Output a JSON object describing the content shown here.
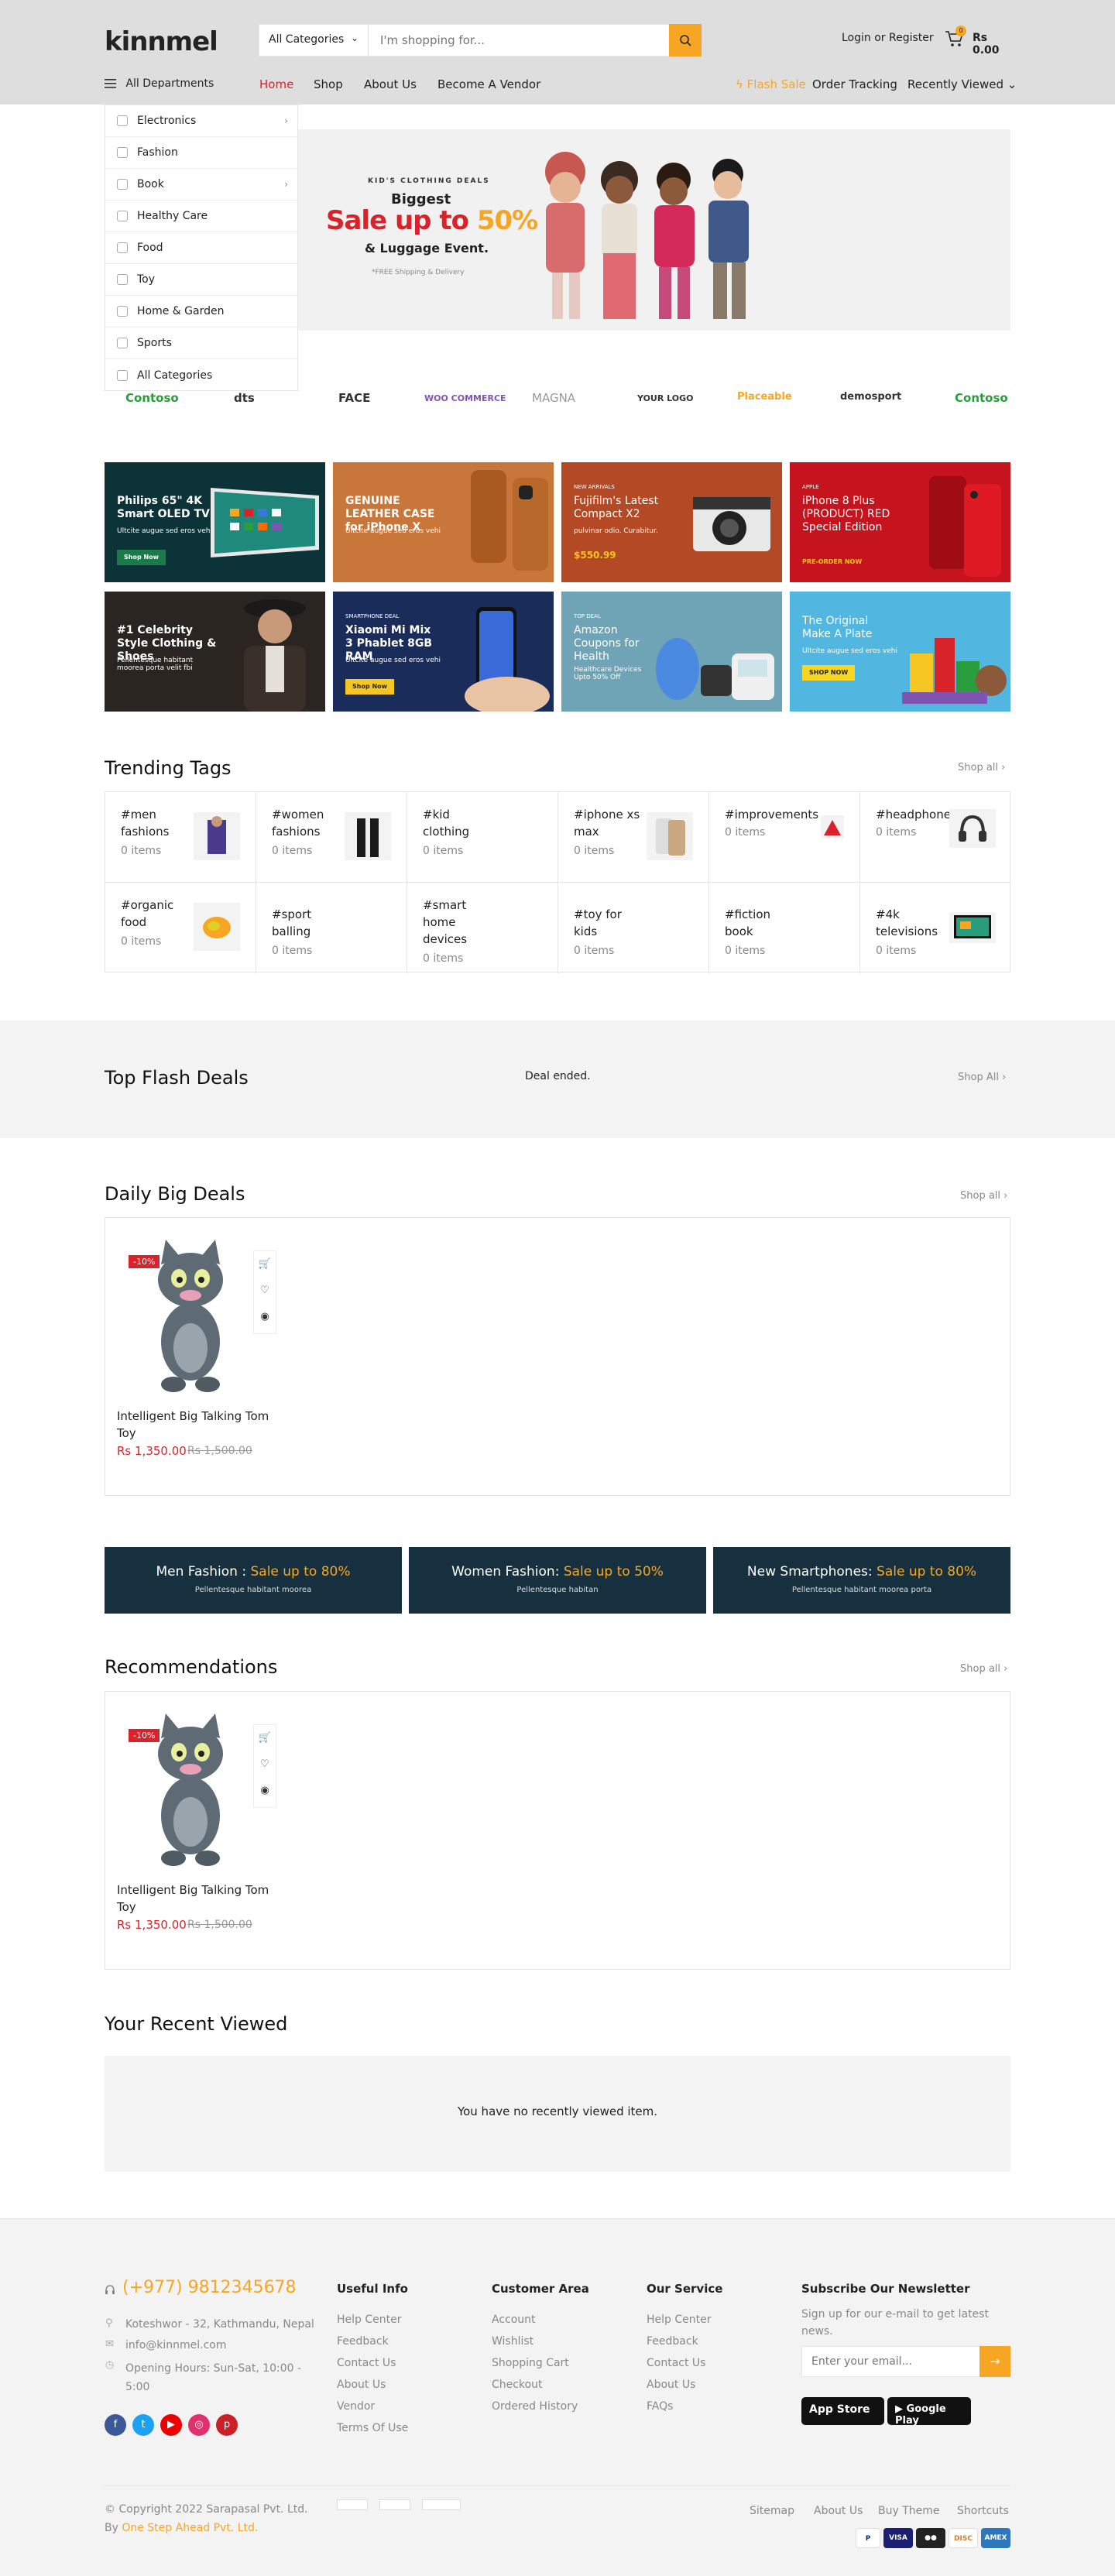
{
  "header": {
    "logo_main": "kinnmel",
    "category_select": "All Categories",
    "search_placeholder": "I'm shopping for...",
    "login": "Login or Register",
    "cart_count": "0",
    "cart_total": "Rs 0.00"
  },
  "nav": {
    "all_departments": "All Departments",
    "menu": [
      "Home",
      "Shop",
      "About Us",
      "Become A Vendor"
    ],
    "right": [
      "Flash Sale",
      "Order Tracking",
      "Recently Viewed"
    ]
  },
  "departments": [
    "Electronics",
    "Fashion",
    "Book",
    "Healthy Care",
    "Food",
    "Toy",
    "Home & Garden",
    "Sports",
    "All Categories"
  ],
  "hero": {
    "eyebrow": "KID'S CLOTHING DEALS",
    "line1": "Biggest",
    "line2": "Sale up to ",
    "line2_accent": "50%",
    "line3": "& Luggage Event.",
    "foot": "*FREE Shipping & Delivery"
  },
  "brands": [
    "Contoso",
    "dts",
    "FACE",
    "WOO COMMERCE",
    "MAGNA",
    "YOUR LOGO",
    "Placeable",
    "demosport",
    "Contoso"
  ],
  "promos": [
    {
      "title": "Philips 65\" 4K Smart OLED TV",
      "sub": "Ultcite augue sed eros vehi",
      "btn": "Shop Now",
      "bg": "#0c3438"
    },
    {
      "title": "GENUINE LEATHER CASE for iPhone X",
      "sub": "Ultcite augue sed eros vehi",
      "btn": "",
      "bg": "#c9763a"
    },
    {
      "title": "Fujifilm's Latest Compact X2",
      "sub": "pulvinar odio. Curabitur.",
      "btn": "$550.99",
      "eyebrow": "NEW ARRIVALS",
      "bg": "#b34a25"
    },
    {
      "title": "iPhone 8 Plus (PRODUCT) RED Special Edition",
      "sub": "",
      "btn": "PRE-ORDER NOW",
      "eyebrow": "APPLE",
      "bg": "#c5141e"
    },
    {
      "title": "#1 Celebrity Style Clothing & Shoes",
      "sub": "Pellentesque habitant moorea porta velit fbi",
      "btn": "",
      "bg": "#2b2522"
    },
    {
      "title": "Xiaomi Mi Mix 3 Phablet 8GB RAM",
      "sub": "Ultcite augue sed eros vehi",
      "btn": "Shop Now",
      "eyebrow": "SMARTPHONE DEAL",
      "bg": "#1a2d5a"
    },
    {
      "title": "Amazon Coupons for Health",
      "sub": "Healthcare Devices Upto 50% Off",
      "btn": "",
      "eyebrow": "TOP DEAL",
      "bg": "#6fa4b6"
    },
    {
      "title": "The Original Make A Plate",
      "sub": "Ultcite augue sed eros vehi",
      "btn": "SHOP NOW",
      "bg": "#52b7e0"
    }
  ],
  "trending": {
    "title": "Trending Tags",
    "shop_all": "Shop all",
    "tags": [
      {
        "name": "#men fashions",
        "count": "0 items"
      },
      {
        "name": "#women fashions",
        "count": "0 items"
      },
      {
        "name": "#kid clothing",
        "count": "0 items"
      },
      {
        "name": "#iphone xs max",
        "count": "0 items"
      },
      {
        "name": "#improvements",
        "count": "0 items"
      },
      {
        "name": "#headphones",
        "count": "0 items"
      },
      {
        "name": "#organic food",
        "count": "0 items"
      },
      {
        "name": "#sport balling",
        "count": "0 items"
      },
      {
        "name": "#smart home devices",
        "count": "0 items"
      },
      {
        "name": "#toy for kids",
        "count": "0 items"
      },
      {
        "name": "#fiction book",
        "count": "0 items"
      },
      {
        "name": "#4k televisions",
        "count": "0 items"
      }
    ]
  },
  "flash": {
    "title": "Top Flash Deals",
    "status": "Deal ended.",
    "shop_all": "Shop All"
  },
  "daily": {
    "title": "Daily Big Deals",
    "shop_all": "Shop all"
  },
  "product": {
    "discount": "-10%",
    "name": "Intelligent Big Talking Tom Toy",
    "price": "Rs 1,350.00",
    "old_price": "Rs 1,500.00"
  },
  "dark_banners": [
    {
      "a": "Men Fashion : ",
      "accent": "Sale up to 80%",
      "b": "Pellentesque habitant moorea"
    },
    {
      "a": "Women Fashion: ",
      "accent": "Sale up to 50%",
      "b": "Pellentesque habitan"
    },
    {
      "a": "New Smartphones: ",
      "accent": "Sale up to 80%",
      "b": "Pellentesque habitant moorea porta"
    }
  ],
  "recommendations": {
    "title": "Recommendations",
    "shop_all": "Shop all"
  },
  "recent": {
    "title": "Your Recent Viewed",
    "empty": "You have no recently viewed item."
  },
  "footer": {
    "phone": "(+977) 9812345678",
    "address": "Koteshwor - 32, Kathmandu, Nepal",
    "email": "info@kinnmel.com",
    "hours": "Opening Hours: Sun-Sat, 10:00 - 5:00",
    "useful_title": "Useful Info",
    "useful": [
      "Help Center",
      "Feedback",
      "Contact Us",
      "About Us",
      "Vendor",
      "Terms Of Use"
    ],
    "customer_title": "Customer Area",
    "customer": [
      "Account",
      "Wishlist",
      "Shopping Cart",
      "Checkout",
      "Ordered History"
    ],
    "service_title": "Our Service",
    "service": [
      "Help Center",
      "Feedback",
      "Contact Us",
      "About Us",
      "FAQs"
    ],
    "newsletter_title": "Subscribe Our Newsletter",
    "newsletter_text": "Sign up for our e-mail to get latest news.",
    "email_placeholder": "Enter your email...",
    "app_store": "App Store",
    "google_play": "Google Play",
    "copyright": "© Copyright 2022 Sarapasal Pvt. Ltd.",
    "by": "By ",
    "by_link": "One Step Ahead Pvt. Ltd.",
    "bottom_links": [
      "Sitemap",
      "About Us",
      "Buy Theme",
      "Shortcuts"
    ]
  }
}
